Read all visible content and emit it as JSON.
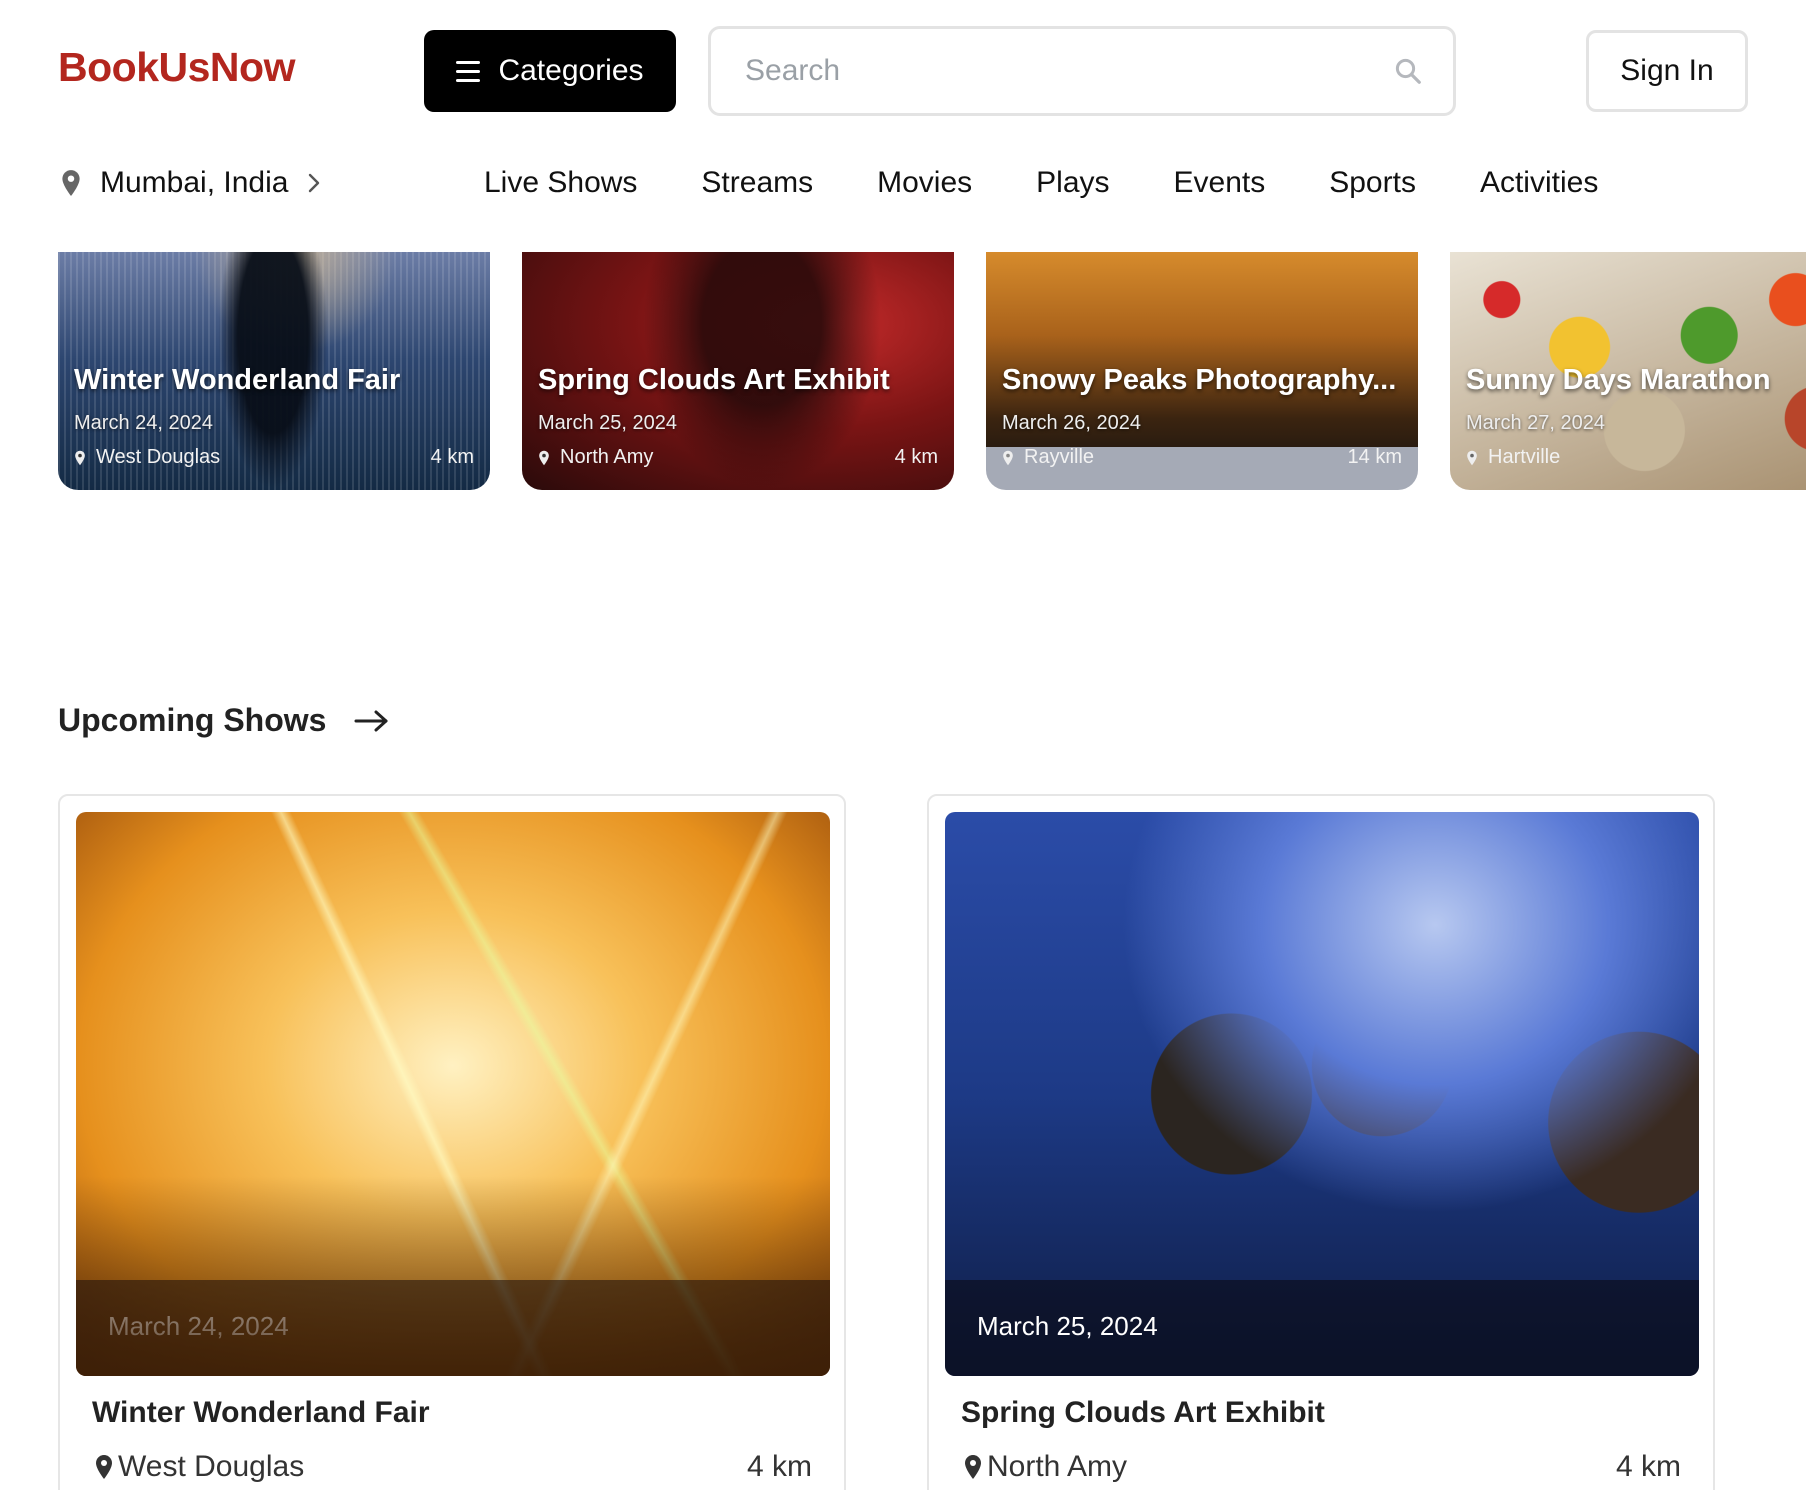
{
  "header": {
    "logo": "BookUsNow",
    "categories_label": "Categories",
    "search_placeholder": "Search",
    "signin_label": "Sign In"
  },
  "location": {
    "label": "Mumbai, India"
  },
  "nav": [
    "Live Shows",
    "Streams",
    "Movies",
    "Plays",
    "Events",
    "Sports",
    "Activities"
  ],
  "carousel": [
    {
      "title": "Winter Wonderland Fair",
      "date": "March 24, 2024",
      "location": "West Douglas",
      "distance": "4 km"
    },
    {
      "title": "Spring Clouds Art Exhibit",
      "date": "March 25, 2024",
      "location": "North Amy",
      "distance": "4 km"
    },
    {
      "title": "Snowy Peaks Photography...",
      "date": "March 26, 2024",
      "location": "Rayville",
      "distance": "14 km"
    },
    {
      "title": "Sunny Days Marathon",
      "date": "March 27, 2024",
      "location": "Hartville",
      "distance": ""
    }
  ],
  "upcoming": {
    "title": "Upcoming Shows",
    "shows": [
      {
        "date": "March 24, 2024",
        "name": "Winter Wonderland Fair",
        "location": "West Douglas",
        "distance": "4 km"
      },
      {
        "date": "March 25, 2024",
        "name": "Spring Clouds Art Exhibit",
        "location": "North Amy",
        "distance": "4 km"
      }
    ]
  },
  "icons": [
    "hamburger-icon",
    "search-icon",
    "location-pin-icon",
    "chevron-right-icon",
    "arrow-right-icon"
  ],
  "colors": {
    "brand": "#b3261e",
    "primary_button": "#000000"
  }
}
